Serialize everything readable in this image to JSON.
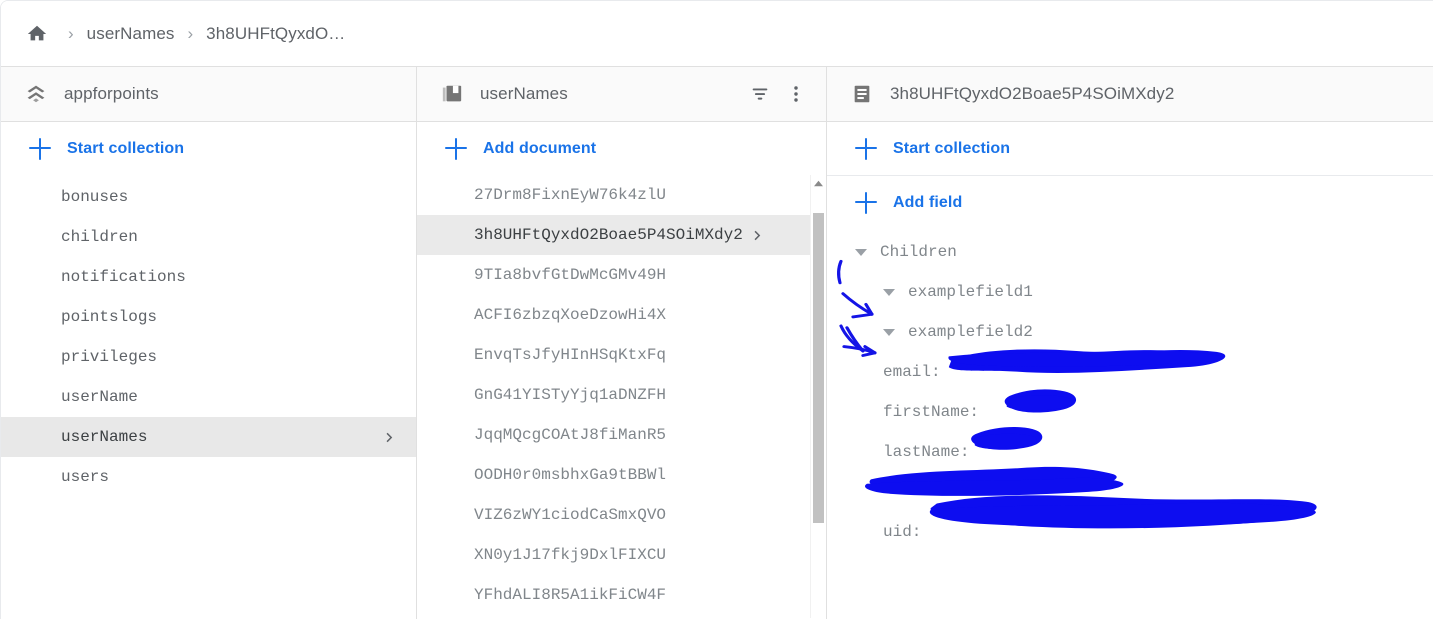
{
  "breadcrumb": {
    "home_icon": "home-icon",
    "separator": "›",
    "items": [
      "userNames",
      "3h8UHFtQyxdO…"
    ]
  },
  "left_panel": {
    "icon": "firestore-database-icon",
    "title": "appforpoints",
    "start_collection_label": "Start collection",
    "collections": [
      {
        "name": "bonuses",
        "selected": false
      },
      {
        "name": "children",
        "selected": false
      },
      {
        "name": "notifications",
        "selected": false
      },
      {
        "name": "pointslogs",
        "selected": false
      },
      {
        "name": "privileges",
        "selected": false
      },
      {
        "name": "userName",
        "selected": false
      },
      {
        "name": "userNames",
        "selected": true
      },
      {
        "name": "users",
        "selected": false
      }
    ]
  },
  "middle_panel": {
    "icon": "collection-icon",
    "title": "userNames",
    "filter_icon": "filter-icon",
    "overflow_icon": "more-vert-icon",
    "add_document_label": "Add document",
    "documents": [
      {
        "id": "27Drm8FixnEyW76k4zlU",
        "selected": false
      },
      {
        "id": "3h8UHFtQyxdO2Boae5P4SOiMXdy2",
        "selected": true
      },
      {
        "id": "9TIa8bvfGtDwMcGMv49H",
        "selected": false
      },
      {
        "id": "ACFI6zbzqXoeDzowHi4X",
        "selected": false
      },
      {
        "id": "EnvqTsJfyHInHSqKtxFq",
        "selected": false
      },
      {
        "id": "GnG41YISTyYjq1aDNZFH",
        "selected": false
      },
      {
        "id": "JqqMQcgCOAtJ8fiManR5",
        "selected": false
      },
      {
        "id": "OODH0r0msbhxGa9tBBWl",
        "selected": false
      },
      {
        "id": "VIZ6zWY1ciodCaSmxQVO",
        "selected": false
      },
      {
        "id": "XN0y1J17fkj9DxlFIXCU",
        "selected": false
      },
      {
        "id": "YFhdALI8R5A1ikFiCW4F",
        "selected": false
      }
    ],
    "chevron": "›"
  },
  "right_panel": {
    "icon": "document-icon",
    "title": "3h8UHFtQyxdO2Boae5P4SOiMXdy2",
    "start_collection_label": "Start collection",
    "add_field_label": "Add field",
    "fields": [
      {
        "name": "Children",
        "kind": "expandable",
        "indent": 0,
        "redacted_value": false
      },
      {
        "name": "examplefield1",
        "kind": "expandable",
        "indent": 1,
        "redacted_value": false
      },
      {
        "name": "examplefield2",
        "kind": "expandable",
        "indent": 1,
        "redacted_value": false
      },
      {
        "name": "email:",
        "kind": "leaf",
        "indent": 1,
        "redacted_value": true
      },
      {
        "name": "firstName:",
        "kind": "leaf",
        "indent": 1,
        "redacted_value": true
      },
      {
        "name": "lastName:",
        "kind": "leaf",
        "indent": 1,
        "redacted_value": true
      },
      {
        "name": "",
        "kind": "leaf",
        "indent": 1,
        "redacted_value": true
      },
      {
        "name": "uid:",
        "kind": "leaf",
        "indent": 1,
        "redacted_value": true
      }
    ]
  },
  "colors": {
    "accent_blue": "#1a73e8",
    "redaction_blue": "#0d0df0",
    "text_gray": "#5f6368",
    "muted_gray": "#80868b",
    "selected_row": "#eaeaea",
    "header_bg": "#fafafa",
    "border": "#e0e0e0"
  }
}
